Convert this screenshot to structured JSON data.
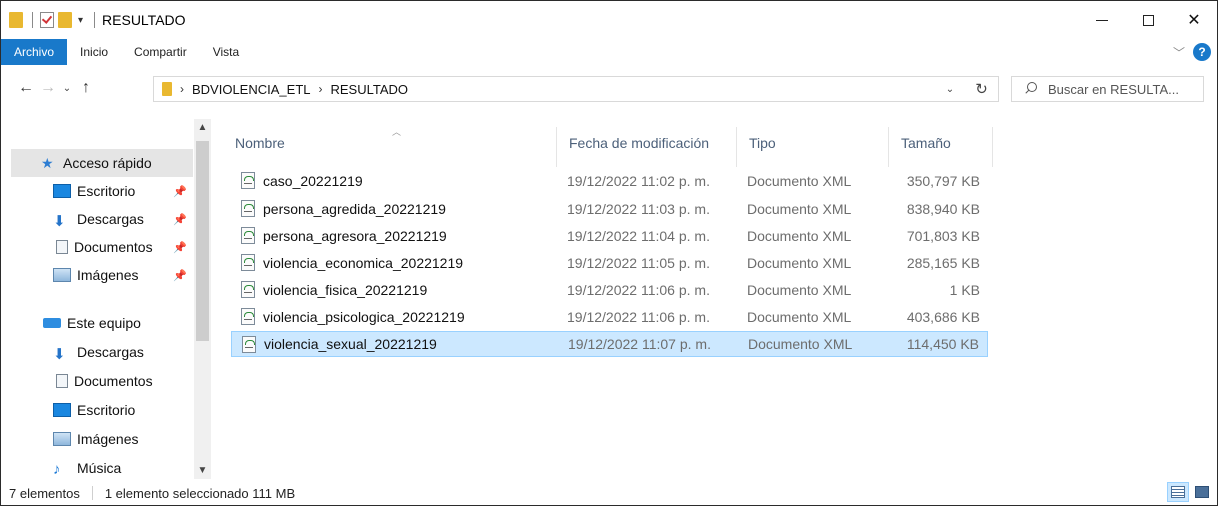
{
  "window": {
    "title": "RESULTADO",
    "controls": {
      "minimize": "—",
      "maximize": "☐",
      "close": "✕"
    }
  },
  "quick_access": {
    "dropdown": "▾"
  },
  "ribbon": {
    "tabs": [
      "Archivo",
      "Inicio",
      "Compartir",
      "Vista"
    ],
    "active_tab": "Archivo",
    "help": "?"
  },
  "address": {
    "breadcrumbs": [
      "BDVIOLENCIA_ETL",
      "RESULTADO"
    ],
    "separator": "›"
  },
  "search": {
    "placeholder": "Buscar en RESULTA..."
  },
  "nav_pane": {
    "quick_access_label": "Acceso rápido",
    "quick_items": [
      {
        "label": "Escritorio",
        "icon": "desktop-icon",
        "pinned": true
      },
      {
        "label": "Descargas",
        "icon": "downloads-icon",
        "pinned": true
      },
      {
        "label": "Documentos",
        "icon": "documents-icon",
        "pinned": true
      },
      {
        "label": "Imágenes",
        "icon": "pictures-icon",
        "pinned": true
      }
    ],
    "this_pc_label": "Este equipo",
    "pc_items": [
      {
        "label": "Descargas",
        "icon": "downloads-icon"
      },
      {
        "label": "Documentos",
        "icon": "documents-icon"
      },
      {
        "label": "Escritorio",
        "icon": "desktop-icon"
      },
      {
        "label": "Imágenes",
        "icon": "pictures-icon"
      },
      {
        "label": "Música",
        "icon": "music-icon"
      }
    ]
  },
  "columns": {
    "name": "Nombre",
    "date": "Fecha de modificación",
    "type": "Tipo",
    "size": "Tamaño"
  },
  "files": [
    {
      "name": "caso_20221219",
      "date": "19/12/2022 11:02 p. m.",
      "type": "Documento XML",
      "size": "350,797 KB",
      "selected": false
    },
    {
      "name": "persona_agredida_20221219",
      "date": "19/12/2022 11:03 p. m.",
      "type": "Documento XML",
      "size": "838,940 KB",
      "selected": false
    },
    {
      "name": "persona_agresora_20221219",
      "date": "19/12/2022 11:04 p. m.",
      "type": "Documento XML",
      "size": "701,803 KB",
      "selected": false
    },
    {
      "name": "violencia_economica_20221219",
      "date": "19/12/2022 11:05 p. m.",
      "type": "Documento XML",
      "size": "285,165 KB",
      "selected": false
    },
    {
      "name": "violencia_fisica_20221219",
      "date": "19/12/2022 11:06 p. m.",
      "type": "Documento XML",
      "size": "1 KB",
      "selected": false
    },
    {
      "name": "violencia_psicologica_20221219",
      "date": "19/12/2022 11:06 p. m.",
      "type": "Documento XML",
      "size": "403,686 KB",
      "selected": false
    },
    {
      "name": "violencia_sexual_20221219",
      "date": "19/12/2022 11:07 p. m.",
      "type": "Documento XML",
      "size": "114,450 KB",
      "selected": true
    }
  ],
  "status": {
    "count": "7 elementos",
    "selection": "1 elemento seleccionado  111 MB"
  },
  "colors": {
    "accent": "#1979ca",
    "selection_bg": "#cce8ff",
    "selection_border": "#99d1ff",
    "header_text": "#4c607a"
  }
}
